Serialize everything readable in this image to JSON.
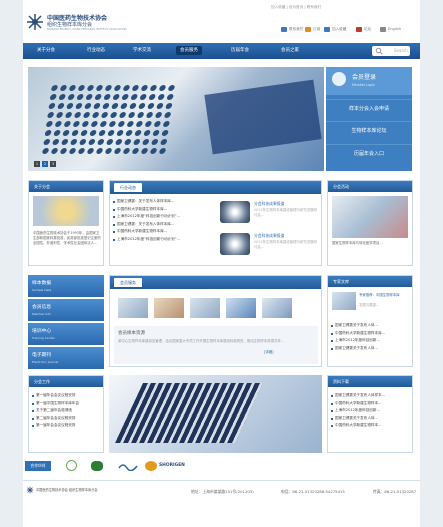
{
  "header": {
    "logo_line1": "中国医药生物技术协会",
    "logo_line2": "组织生物样本库分会",
    "logo_line3": "BIOBANK BRANCH, CHINA MEDICINAL BIOTECH ASSOCIATION",
    "quick_links": "加入收藏 | 设为首页 | 联系我们",
    "utility": [
      {
        "label": "联系我们",
        "color": "#3b78c2"
      },
      {
        "label": "订阅",
        "color": "#e48b1d"
      },
      {
        "label": "加入收藏",
        "color": "#3b78c2"
      },
      {
        "label": "论坛",
        "color": "#c0392b"
      },
      {
        "label": "English",
        "color": "#888888"
      }
    ]
  },
  "nav": {
    "items": [
      "关于分会",
      "行业动态",
      "学术交流",
      "会员服务",
      "历届年会",
      "会员之家"
    ],
    "active_index": 3,
    "search_placeholder": "Search"
  },
  "banner": {
    "pages": [
      "1",
      "2",
      "3"
    ],
    "active_page": 1
  },
  "side_panel": {
    "login_title": "会员登录",
    "login_sub": "Member Login",
    "buttons": [
      "样本分会入会申请",
      "生物样本库论坛",
      "历届年会入口"
    ]
  },
  "about": {
    "title": "关于分会",
    "text": "中国医药生物技术协会于1993年，由国家卫生部和国家科委批准，民政部批准登记注册的全国性、非营利性、学术性社会团体法人..."
  },
  "news": {
    "tab": "行业动态",
    "items": [
      "国家卫健委：关于发布人体样本库...",
      "中国药科大学新建生物样本库...",
      "上海市2012年度“科技创新行动计划”...",
      "国家卫健委：关于发布人体样本库...",
      "中国药科大学新建生物样本库...",
      "上海市2012年度“科技创新行动计划”..."
    ],
    "thumbs": [
      {
        "title": "分会科技成果报道",
        "text": "2012年生物样本库建设管理与研究进展研讨会..."
      },
      {
        "title": "分会科技成果报道",
        "text": "2012年生物样本库建设管理与研究进展研讨会..."
      }
    ]
  },
  "activity": {
    "title": "分会活动",
    "caption": "国家生物样本库与转化医学项目..."
  },
  "services": {
    "title": "会员服务",
    "heading": "会员样本资源",
    "text": "某中心生物样本库建设及管理，结合国家重大专项工作开展生物样本库建设标准规范，推动生物样本资源共享...",
    "more": "[详细]"
  },
  "quick_buttons": [
    {
      "title": "样本数据",
      "sub": "Sample Data"
    },
    {
      "title": "会员信息",
      "sub": "Member Info"
    },
    {
      "title": "培训中心",
      "sub": "Training Center"
    },
    {
      "title": "电子期刊",
      "sub": "Electronic Journal"
    }
  ],
  "special": {
    "title": "分会工作",
    "items": [
      "第一届年会会议议程安排",
      "第一届中国生物样本库年会",
      "关于第二届年会邀请函",
      "第二届年会会议议程安排",
      "第一届年会会议议程安排"
    ]
  },
  "expert": {
    "title": "专家文库",
    "card_title": "专家推荐：中国生物样本库",
    "card_text": "发展与展望...",
    "items": [
      "国家卫健委关于发布人体...",
      "中国药科大学新建生物样本库...",
      "上海市2012年度科技创新...",
      "国家卫健委关于发布人体..."
    ]
  },
  "download": {
    "title": "资料下载",
    "items": [
      "国家卫健委关于发布人体样本...",
      "中国药科大学新建生物样本...",
      "上海市2012年度科技创新...",
      "国家卫健委关于发布人体...",
      "中国药科大学新建生物样本..."
    ]
  },
  "partners": {
    "title": "合作伙伴",
    "logo_text": "SHORIGEN"
  },
  "footer": {
    "org": "中国医药生物技术协会 组织生物样本库分会",
    "address": "地址：上海市某某路151号(201203)",
    "phone": "电话：86-21-51320288-54275415",
    "fax": "传真：86-21-51320287"
  }
}
